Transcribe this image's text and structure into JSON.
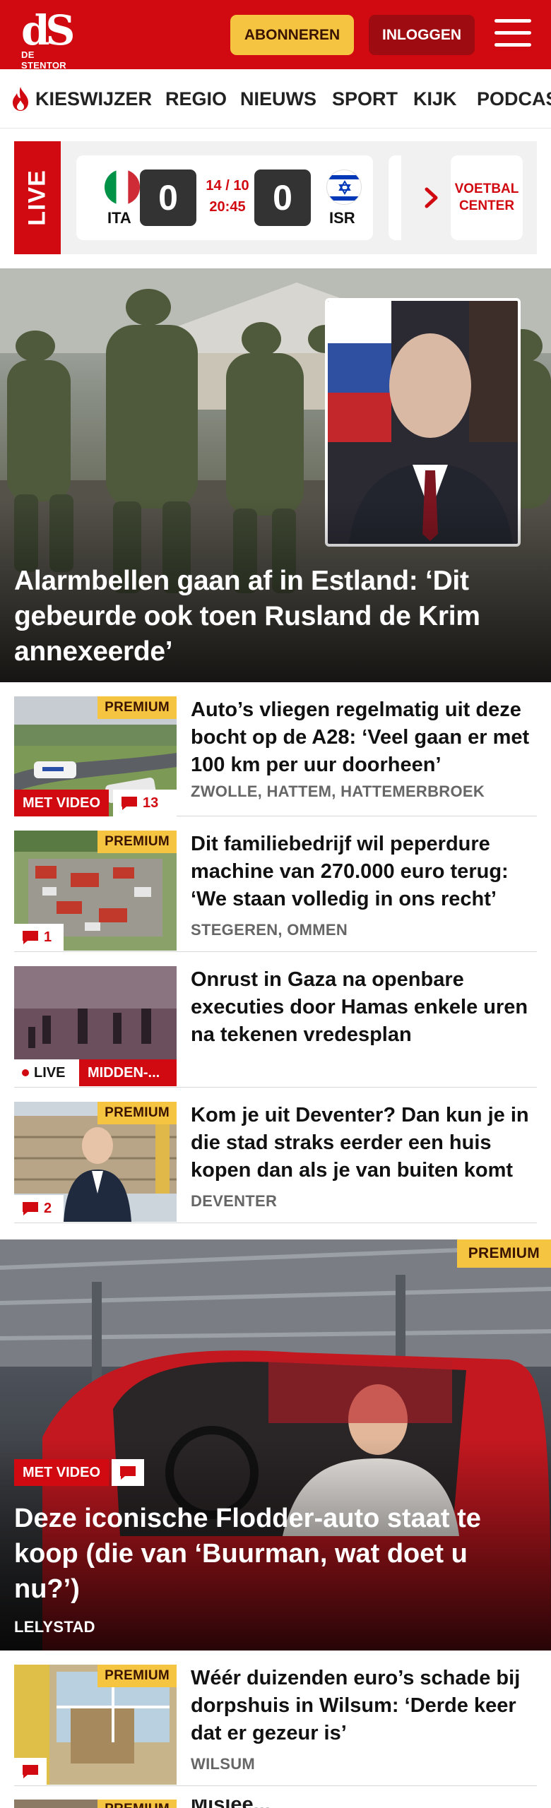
{
  "header": {
    "logo_text": "dS",
    "logo_subtitle": "DE STENTOR",
    "subscribe_label": "ABONNEREN",
    "login_label": "INLOGGEN",
    "brand_color": "#d10a11",
    "accent_color": "#f5c542"
  },
  "nav": {
    "items": [
      "KIESWIJZER",
      "REGIO",
      "NIEUWS",
      "SPORT",
      "KIJK",
      "PODCAS"
    ]
  },
  "live": {
    "label": "LIVE",
    "match": {
      "home_code": "ITA",
      "away_code": "ISR",
      "home_score": "0",
      "away_score": "0",
      "date": "14 / 10",
      "time": "20:45"
    },
    "voetbal_center_label": "VOETBAL CENTER"
  },
  "hero": {
    "title": "Alarmbellen gaan af in Estland: ‘Dit gebeurde ook toen Rusland de Krim annexeerde’"
  },
  "articles": [
    {
      "premium": "PREMIUM",
      "title": "Auto’s vliegen regelmatig uit deze bocht op de A28: ‘Veel gaan er met 100 km per uur doorheen’",
      "location": "ZWOLLE, HATTEM, HATTEMERBROEK",
      "video_label": "MET VIDEO",
      "comments": "13"
    },
    {
      "premium": "PREMIUM",
      "title": "Dit familiebedrijf wil peperdure machine van 270.000 euro terug: ‘We staan volledig in ons recht’",
      "location": "STEGEREN, OMMEN",
      "comments": "1"
    },
    {
      "title": "Onrust in Gaza na openbare executies door Hamas enkele uren na tekenen vredesplan",
      "live_label": "LIVE",
      "section_label": "MIDDEN-..."
    },
    {
      "premium": "PREMIUM",
      "title": "Kom je uit Deventer? Dan kun je in die stad straks eerder een huis kopen dan als je van buiten komt",
      "location": "DEVENTER",
      "comments": "2"
    }
  ],
  "feature": {
    "premium": "PREMIUM",
    "video_label": "MET VIDEO",
    "title": "Deze iconische Flodder-auto staat te koop (die van ‘Buurman, wat doet u nu?’)",
    "location": "LELYSTAD"
  },
  "article_after": {
    "premium": "PREMIUM",
    "title": "Wéér duizenden euro’s schade bij dorpshuis in Wilsum: ‘Derde keer dat er gezeur is’",
    "location": "WILSUM"
  },
  "partial_next": {
    "premium": "PREMIUM",
    "title_fragment": "Mislee..."
  }
}
